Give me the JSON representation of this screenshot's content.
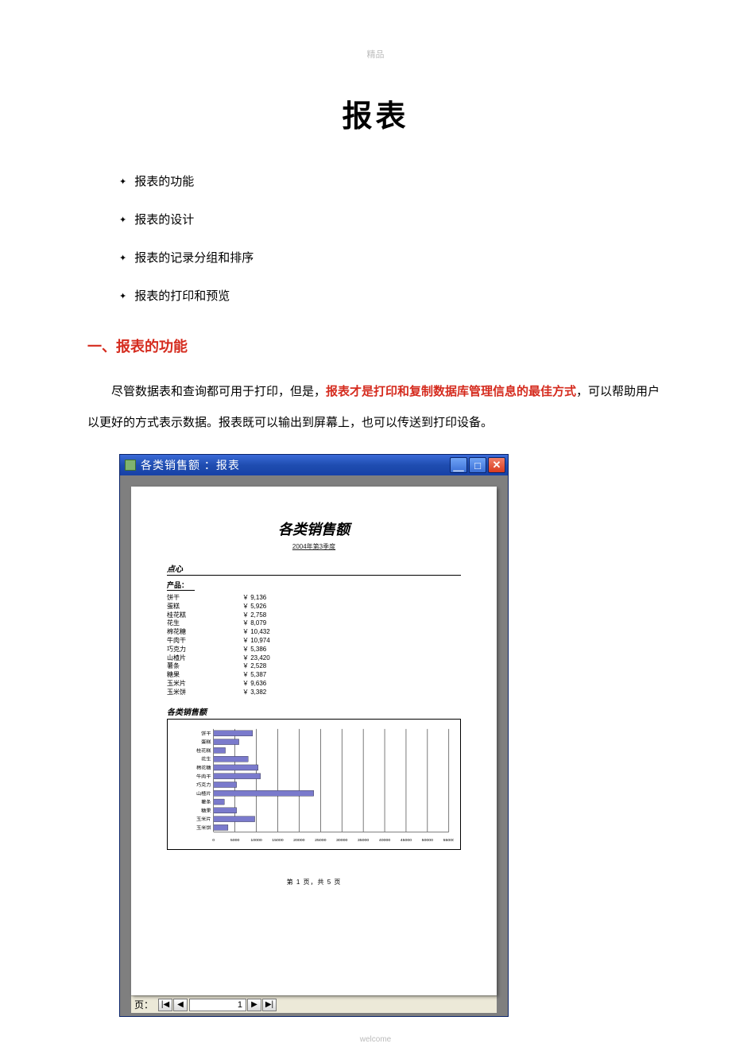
{
  "header_mark": "精品",
  "footer_mark": "welcome",
  "title": "报表",
  "toc": [
    "报表的功能",
    "报表的设计",
    "报表的记录分组和排序",
    "报表的打印和预览"
  ],
  "section_heading": "一、报表的功能",
  "para_lead": "尽管数据表和查询都可用于打印，但是，",
  "para_em": "报表才是打印和复制数据库管理信息的最佳方式",
  "para_tail": "，可以帮助用户以更好的方式表示数据。报表既可以输出到屏幕上，也可以传送到打印设备。",
  "window": {
    "title": "各类销售额 ：报表",
    "min": "＿",
    "max": "□",
    "close": "✕"
  },
  "report": {
    "title": "各类销售额",
    "subtitle": "2004年第3季度",
    "category_label": "点心",
    "col_header": "产品：",
    "rows": [
      {
        "name": "饼干",
        "value": "￥ 9,136"
      },
      {
        "name": "蛋糕",
        "value": "￥ 5,926"
      },
      {
        "name": "桂花糕",
        "value": "￥ 2,758"
      },
      {
        "name": "花生",
        "value": "￥ 8,079"
      },
      {
        "name": "棉花糖",
        "value": "￥ 10,432"
      },
      {
        "name": "牛肉干",
        "value": "￥ 10,974"
      },
      {
        "name": "巧克力",
        "value": "￥ 5,386"
      },
      {
        "name": "山楂片",
        "value": "￥ 23,420"
      },
      {
        "name": "薯条",
        "value": "￥ 2,528"
      },
      {
        "name": "糖果",
        "value": "￥ 5,387"
      },
      {
        "name": "玉米片",
        "value": "￥ 9,636"
      },
      {
        "name": "玉米饼",
        "value": "￥ 3,382"
      }
    ],
    "chart_label": "各类销售额",
    "page_label": "第 1 页，共 5 页"
  },
  "nav": {
    "label": "页：",
    "first": "|◀",
    "prev": "◀",
    "value": "1",
    "next": "▶",
    "last": "▶|"
  },
  "chart_data": {
    "type": "bar",
    "orientation": "horizontal",
    "categories": [
      "饼干",
      "蛋糕",
      "桂花糕",
      "花生",
      "棉花糖",
      "牛肉干",
      "巧克力",
      "山楂片",
      "薯条",
      "糖果",
      "玉米片",
      "玉米饼"
    ],
    "values": [
      9136,
      5926,
      2758,
      8079,
      10432,
      10974,
      5386,
      23420,
      2528,
      5387,
      9636,
      3382
    ],
    "xlim": [
      0,
      55000
    ],
    "xticks": [
      0,
      5000,
      10000,
      15000,
      20000,
      25000,
      30000,
      35000,
      40000,
      45000,
      50000,
      55000
    ]
  }
}
